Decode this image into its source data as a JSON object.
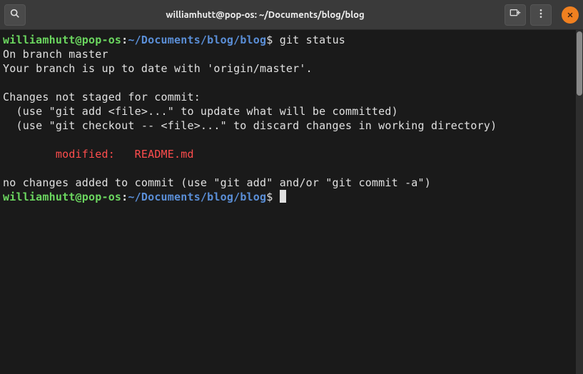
{
  "titlebar": {
    "title": "williamhutt@pop-os: ~/Documents/blog/blog"
  },
  "prompt1": {
    "user_host": "williamhutt@pop-os",
    "sep": ":",
    "path": "~/Documents/blog/blog",
    "dollar": "$ ",
    "command": "git status"
  },
  "output": {
    "l1": "On branch master",
    "l2": "Your branch is up to date with 'origin/master'.",
    "l3": "",
    "l4": "Changes not staged for commit:",
    "l5": "  (use \"git add <file>...\" to update what will be committed)",
    "l6": "  (use \"git checkout -- <file>...\" to discard changes in working directory)",
    "l7": "",
    "l8_prefix": "        ",
    "l8_red": "modified:   README.md",
    "l9": "",
    "l10": "no changes added to commit (use \"git add\" and/or \"git commit -a\")"
  },
  "prompt2": {
    "user_host": "williamhutt@pop-os",
    "sep": ":",
    "path": "~/Documents/blog/blog",
    "dollar": "$ "
  }
}
